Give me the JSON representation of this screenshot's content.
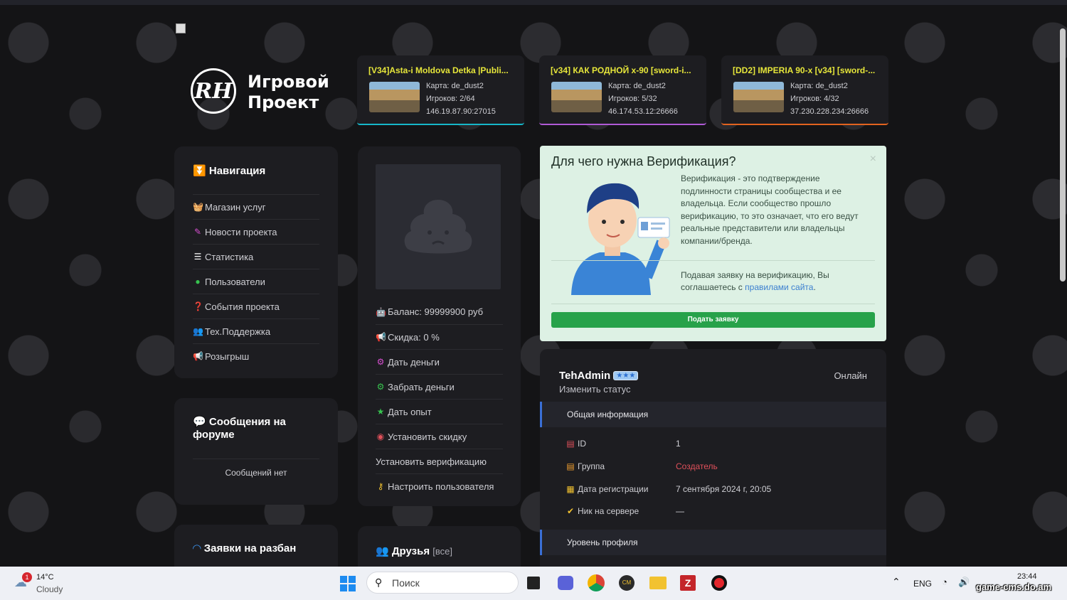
{
  "site": {
    "logo_mark": "RH",
    "logo_line1": "Игровой",
    "logo_line2": "Проект"
  },
  "servers": [
    {
      "name": "[V34]Asta-i Moldova Detka |Publi...",
      "map": "Карта: de_dust2",
      "players": "Игроков: 2/64",
      "address": "146.19.87.90:27015",
      "accent": "#16b7c9"
    },
    {
      "name": "[v34] КАК РОДНОЙ x-90 [sword-i...",
      "map": "Карта: de_dust2",
      "players": "Игроков: 5/32",
      "address": "46.174.53.12:26666",
      "accent": "#b05ad6"
    },
    {
      "name": "[DD2] IMPERIA 90-x [v34] [sword-...",
      "map": "Карта: de_dust2",
      "players": "Игроков: 4/32",
      "address": "37.230.228.234:26666",
      "accent": "#e2631f"
    }
  ],
  "navigation": {
    "title": "Навигация",
    "items": [
      {
        "label": "Магазин услуг",
        "icon": "basket-icon",
        "color": "#f2c230"
      },
      {
        "label": "Новости проекта",
        "icon": "magic-wand-icon",
        "color": "#d64fd0"
      },
      {
        "label": "Статистика",
        "icon": "list-icon",
        "color": "#ffffff"
      },
      {
        "label": "Пользователи",
        "icon": "user-icon",
        "color": "#37c24f"
      },
      {
        "label": "События проекта",
        "icon": "question-icon",
        "color": "#1fb5d6"
      },
      {
        "label": "Тех.Поддержка",
        "icon": "users-icon",
        "color": "#8a6ae0"
      },
      {
        "label": "Розыгрыш",
        "icon": "megaphone-icon",
        "color": "#f2c230"
      }
    ]
  },
  "forum": {
    "title": "Сообщения на форуме",
    "empty": "Сообщений нет"
  },
  "requests": {
    "title": "Заявки на разбан"
  },
  "admin_menu": {
    "items": [
      {
        "label": "Баланс: 99999900 руб",
        "icon": "android-icon",
        "color": "#37c24f"
      },
      {
        "label": "Скидка: 0 %",
        "icon": "megaphone-icon",
        "color": "#f2c230"
      },
      {
        "label": "Дать деньги",
        "icon": "gear-icon",
        "color": "#d64fd0"
      },
      {
        "label": "Забрать деньги",
        "icon": "gear-icon",
        "color": "#37c24f"
      },
      {
        "label": "Дать опыт",
        "icon": "star-icon",
        "color": "#37c24f"
      },
      {
        "label": "Установить скидку",
        "icon": "eye-icon",
        "color": "#e0505a"
      },
      {
        "label": "Установить верификацию",
        "icon": "",
        "color": "#cfcfd4"
      },
      {
        "label": "Настроить пользователя",
        "icon": "key-icon",
        "color": "#f2c230"
      }
    ]
  },
  "friends": {
    "title": "Друзья",
    "all": "[все]"
  },
  "verification": {
    "title": "Для чего нужна Верификация?",
    "close": "×",
    "text": "Верификация - это подтверждение подлинности страницы сообщества и ее владельца. Если сообщество прошло верификацию, то это означает, что его ведут реальные представители или владельцы компании/бренда.",
    "agree_prefix": "Подавая заявку на верификацию, Вы соглашаетесь с ",
    "agree_link": "правилами сайта",
    "agree_suffix": ".",
    "button": "Подать заявку"
  },
  "profile": {
    "name": "TehAdmin",
    "badge": "★★★",
    "status_link": "Изменить статус",
    "online": "Онлайн",
    "general_header": "Общая информация",
    "rows": [
      {
        "label": "ID",
        "value": "1",
        "icon": "id-card-icon"
      },
      {
        "label": "Группа",
        "value": "Создатель",
        "icon": "id-card-icon"
      },
      {
        "label": "Дата регистрации",
        "value": "7 сентября 2024 г, 20:05",
        "icon": "calendar-icon"
      },
      {
        "label": "Ник на сервере",
        "value": "—",
        "icon": "check-circle-icon"
      }
    ],
    "group_color": "#e0505a",
    "level_header": "Уровень профиля"
  },
  "taskbar": {
    "weather_badge": "1",
    "temp": "14°C",
    "weather": "Cloudy",
    "search": "Поиск",
    "lang": "ENG",
    "time": "23:44",
    "watermark": "game-cms.do.am"
  }
}
